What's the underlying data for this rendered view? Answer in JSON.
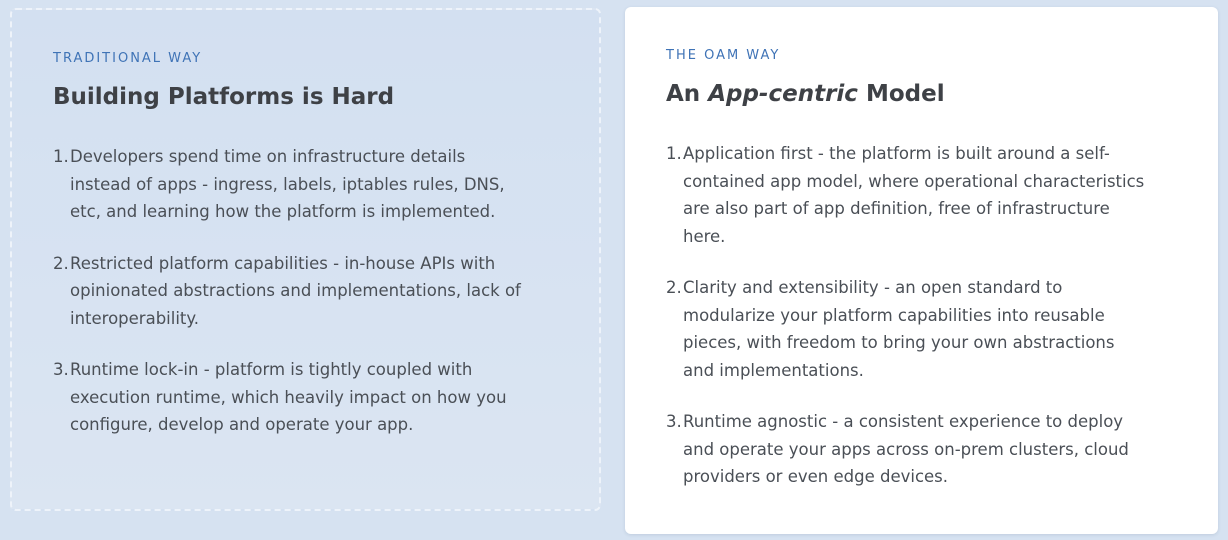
{
  "traditional": {
    "eyebrow": "TRADITIONAL WAY",
    "title": "Building Platforms is Hard",
    "items": [
      {
        "num": "1.",
        "text": "Developers spend time on infrastructure details instead of apps - ingress, labels, iptables rules, DNS, etc, and learning how the platform is implemented."
      },
      {
        "num": "2.",
        "text": "Restricted platform capabilities - in-house APIs with opinionated abstractions and implementations, lack of interoperability."
      },
      {
        "num": "3.",
        "text": "Runtime lock-in - platform is tightly coupled with execution runtime, which heavily impact on how you configure, develop and operate your app."
      }
    ]
  },
  "oam": {
    "eyebrow": "THE OAM WAY",
    "title_prefix": "An ",
    "title_emphasis": "App-centric",
    "title_suffix": " Model",
    "items": [
      {
        "num": "1.",
        "text": "Application first - the platform is built around a self-contained app model, where operational characteristics are also part of app definition, free of infrastructure here."
      },
      {
        "num": "2.",
        "text": "Clarity and extensibility - an open standard to modularize your platform capabilities into reusable pieces, with freedom to bring your own abstractions and implementations."
      },
      {
        "num": "3.",
        "text": "Runtime agnostic - a consistent experience to deploy and operate your apps across on-prem clusters, cloud providers or even edge devices."
      }
    ]
  },
  "colors": {
    "page_background": "#d6e2f1",
    "eyebrow": "#3f73b6",
    "heading": "#3e4146",
    "body_text": "#4a4f56",
    "right_card": "#ffffff"
  }
}
